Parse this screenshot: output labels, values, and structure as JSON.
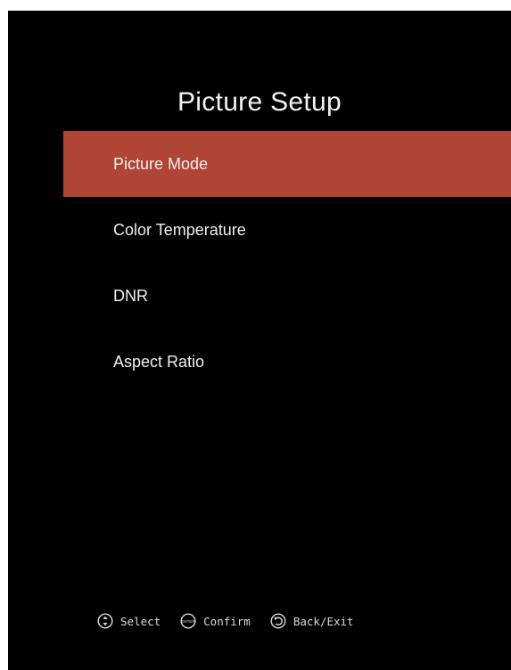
{
  "theme": {
    "background": "#000000",
    "accent": "#b04535",
    "text": "#f0f0f0"
  },
  "title": "Picture Setup",
  "menu": {
    "selected_index": 0,
    "items": [
      {
        "label": "Picture Mode"
      },
      {
        "label": "Color Temperature"
      },
      {
        "label": "DNR"
      },
      {
        "label": "Aspect Ratio"
      }
    ]
  },
  "footer": {
    "hints": [
      {
        "icon": "dpad-icon",
        "label": "Select"
      },
      {
        "icon": "enter-button-icon",
        "icon_text": "ENTER",
        "label": "Confirm"
      },
      {
        "icon": "back-arrow-icon",
        "label": "Back/Exit"
      }
    ]
  }
}
